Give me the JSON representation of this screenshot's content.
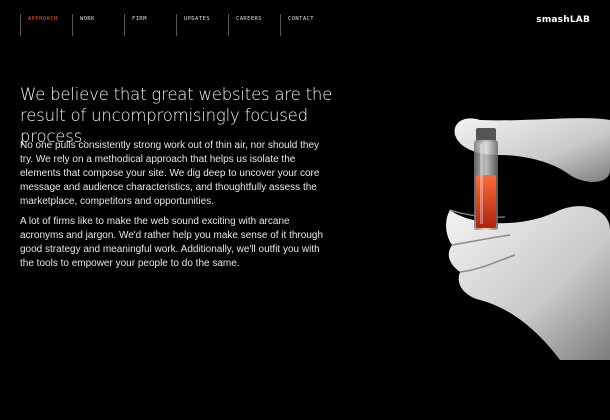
{
  "nav": {
    "items": [
      {
        "label": "APPROACH"
      },
      {
        "label": "WORK"
      },
      {
        "label": "FIRM"
      },
      {
        "label": "UPDATES"
      },
      {
        "label": "CAREERS"
      },
      {
        "label": "CONTACT"
      }
    ]
  },
  "brand": {
    "logo": "smashLAB"
  },
  "content": {
    "headline": "We believe that great websites are the result of uncompromisingly focused process.",
    "paragraphs": [
      "No one pulls consistently strong work out of thin air, nor should they try. We rely on a methodical approach that helps us isolate the elements that compose your site. We dig deep to uncover your core message and audience characteristics, and thoughtfully assess the marketplace, competitors and opportunities.",
      "A lot of firms like to make the web sound exciting with arcane acronyms and jargon. We'd rather help you make sense of it through good strategy and meaningful work. Additionally, we'll outfit you with the tools to empower your people to do the same."
    ]
  },
  "colors": {
    "background": "#000000",
    "accent": "#e85a2a",
    "text": "#ffffff"
  },
  "image": {
    "subject": "gloved-hand-holding-vial"
  }
}
